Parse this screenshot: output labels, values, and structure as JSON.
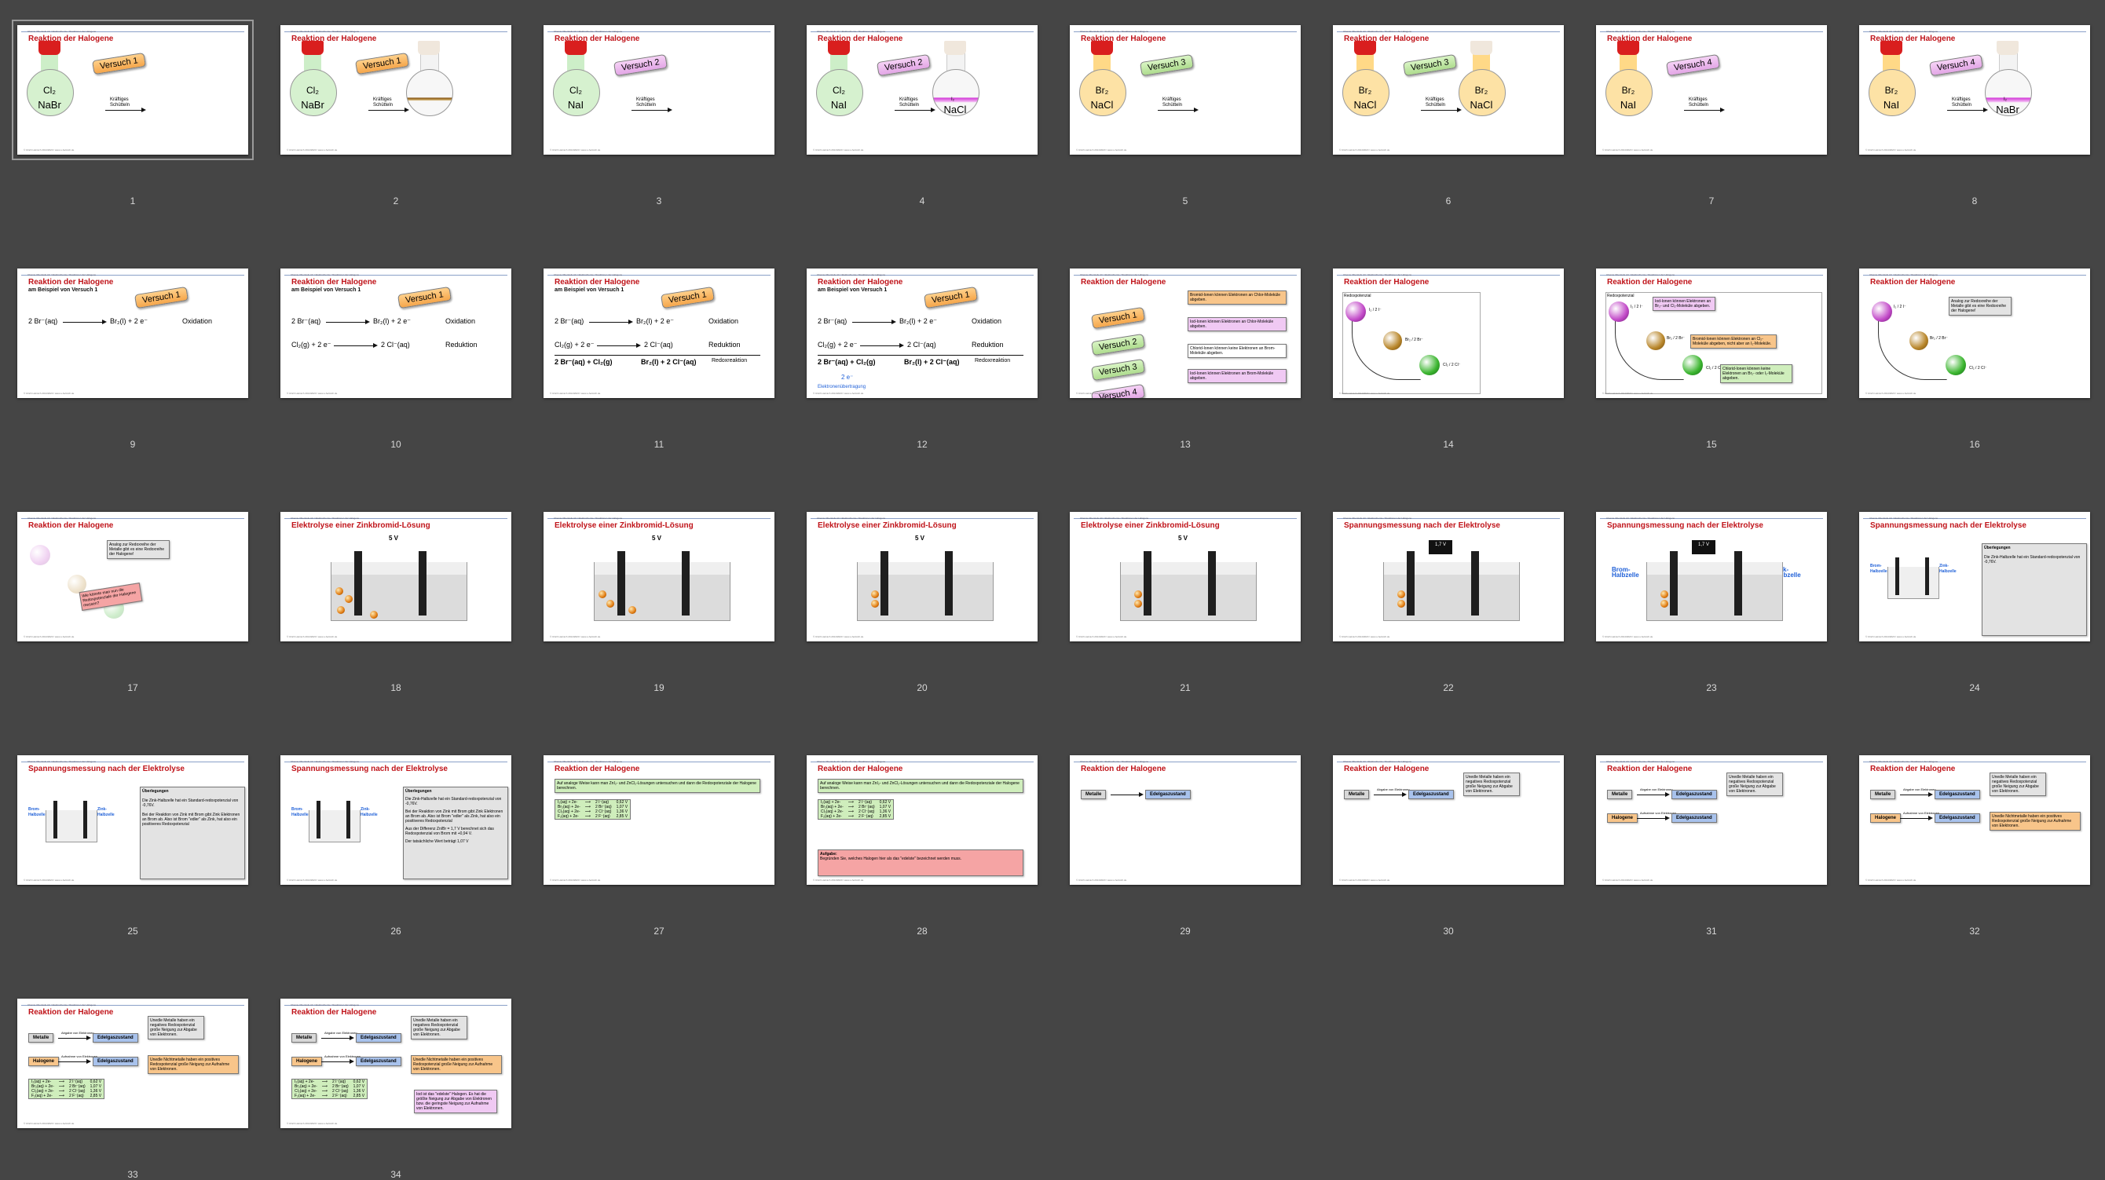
{
  "header_text": "Chemie Oberstufe AC / Elektrochemie / Reaktionen der Halogene",
  "footer_text": "© Ulrich Helmich 2014/2020 / www.u-helmich.de",
  "slide_numbers": [
    "1",
    "2",
    "3",
    "4",
    "5",
    "6",
    "7",
    "8",
    "9",
    "10",
    "11",
    "12",
    "13",
    "14",
    "15",
    "16",
    "17",
    "18",
    "19",
    "20",
    "21",
    "22",
    "23",
    "24",
    "25",
    "26",
    "27",
    "28",
    "29",
    "30",
    "31",
    "32",
    "33",
    "34"
  ],
  "titles": {
    "halogene": "Reaktion der Halogene",
    "elektrolyse": "Elektrolyse einer Zinkbromid-Lösung",
    "spannung": "Spannungsmessung nach der Elektrolyse"
  },
  "subtitle_v1": "am Beispiel von Versuch 1",
  "versuch": {
    "v1": "Versuch 1",
    "v2": "Versuch 2",
    "v3": "Versuch 3",
    "v4": "Versuch 4"
  },
  "flask": {
    "cl2": "Cl₂",
    "br2": "Br₂",
    "nabr": "NaBr",
    "nai": "NaI",
    "nacl": "NaCl",
    "i2": "I₂",
    "shake": "Kräftiges\nSchütteln"
  },
  "eq": {
    "l1a": "2 Br⁻(aq)",
    "l1b": "Br₂(l) + 2 e⁻",
    "ox": "Oxidation",
    "l2a": "Cl₂(g) + 2 e⁻",
    "l2b": "2 Cl⁻(aq)",
    "red": "Reduktion",
    "l3a": "2 Br⁻(aq) + Cl₂(g)",
    "l3b": "Br₂(l) + 2 Cl⁻(aq)",
    "redox": "Redoxreaktion",
    "e2": "2 e⁻",
    "transfer": "Elektronenübertragung"
  },
  "notes13": {
    "n1": "Bromid-Ionen können Elektronen an Chlor-Moleküle abgeben.",
    "n2": "Iod-Ionen können Elektronen an Chlor-Moleküle abgeben.",
    "n3": "Chlorid-Ionen können keine Elektronen an Brom-Moleküle abgeben.",
    "n4": "Iod-Ionen können Elektronen an Brom-Moleküle abgeben."
  },
  "redox_axis": "Redoxpotenzial",
  "balls": {
    "i": "I₂ / 2 I⁻",
    "br": "Br₂ / 2 Br⁻",
    "cl": "Cl₂ / 2 Cl⁻"
  },
  "notes15": {
    "n1": "Iod-Ionen können Elektronen an Br₂- und Cl₂-Moleküle abgeben.",
    "n2": "Bromid-Ionen können Elektronen an Cl₂-Moleküle abgeben, nicht aber an I₂-Moleküle.",
    "n3": "Chlorid-Ionen können keine Elektronen an Br₂- oder I₂-Moleküle abgeben."
  },
  "note16": "Analog zur Redoxreihe der Metalle gibt es eine Redoxreihe der Halogene!",
  "note17": "Wie könnte man nun die Redoxpotenziale der Halogene messen?",
  "voltage": "5 V",
  "v17": "1,7 V",
  "plus": "+",
  "minus": "−",
  "brom_hz": "Brom-\nHalbzelle",
  "zink_hz": "Zink-\nHalbzelle",
  "ueberl": "Überlegungen",
  "ueb1": "Die Zink-Halbzelle hat ein Standard-redoxpotenzial von -0,76V.",
  "ueb2": "Bei der Reaktion von Zink mit Brom gibt Zink Elektronen an Brom ab. Also ist Brom \"edler\" als Zink, hat also ein positiveres Redoxpotenzial",
  "ueb3": "Aus der Differenz Zn/Br = 1,7 V berechnet sich das Redoxpotenzial von Brom mit +0,94 V.",
  "ueb4": "Der tatsächliche Wert beträgt 1,07 V",
  "auf27": "Auf analoge Weise kann man ZnI₂- und ZnCl₂-Lösungen untersuchen und dann die Redoxpotenziale der Halogene berechnen.",
  "ptable": [
    [
      "I₂(aq) + 2e-",
      "2 I⁻(aq)",
      "0,62 V"
    ],
    [
      "Br₂(aq) + 2e-",
      "2 Br⁻(aq)",
      "1,07 V"
    ],
    [
      "Cl₂(aq) + 2e-",
      "2 Cl⁻(aq)",
      "1,36 V"
    ],
    [
      "F₂(aq) + 2e-",
      "2 F⁻(aq)",
      "2,85 V"
    ]
  ],
  "aufgabe_h": "Aufgabe:",
  "aufgabe_t": "Begründen Sie, welches Halogen hier als das \"edelste\" bezeichnet werden muss.",
  "gb": {
    "metalle": "Metalle",
    "edelgas": "Edelgaszustand",
    "halogene": "Halogene",
    "abgabe": "Abgabe von Elektronen",
    "aufnahme": "Aufnahme von Elektronen"
  },
  "note30": "Unedle Metalle haben ein negatives Redoxpotenzial große Neigung zur Abgabe von Elektronen.",
  "note32": "Unedle Nichtmetalle haben ein positives Redoxpotenzial große Neigung zur Aufnahme von Elektronen.",
  "note34": "Iod ist das \"edelste\" Halogen. Es hat die größte Neigung zur Abgabe von Elektronen bzw. die geringste Neigung zur Aufnahme von Elektronen."
}
